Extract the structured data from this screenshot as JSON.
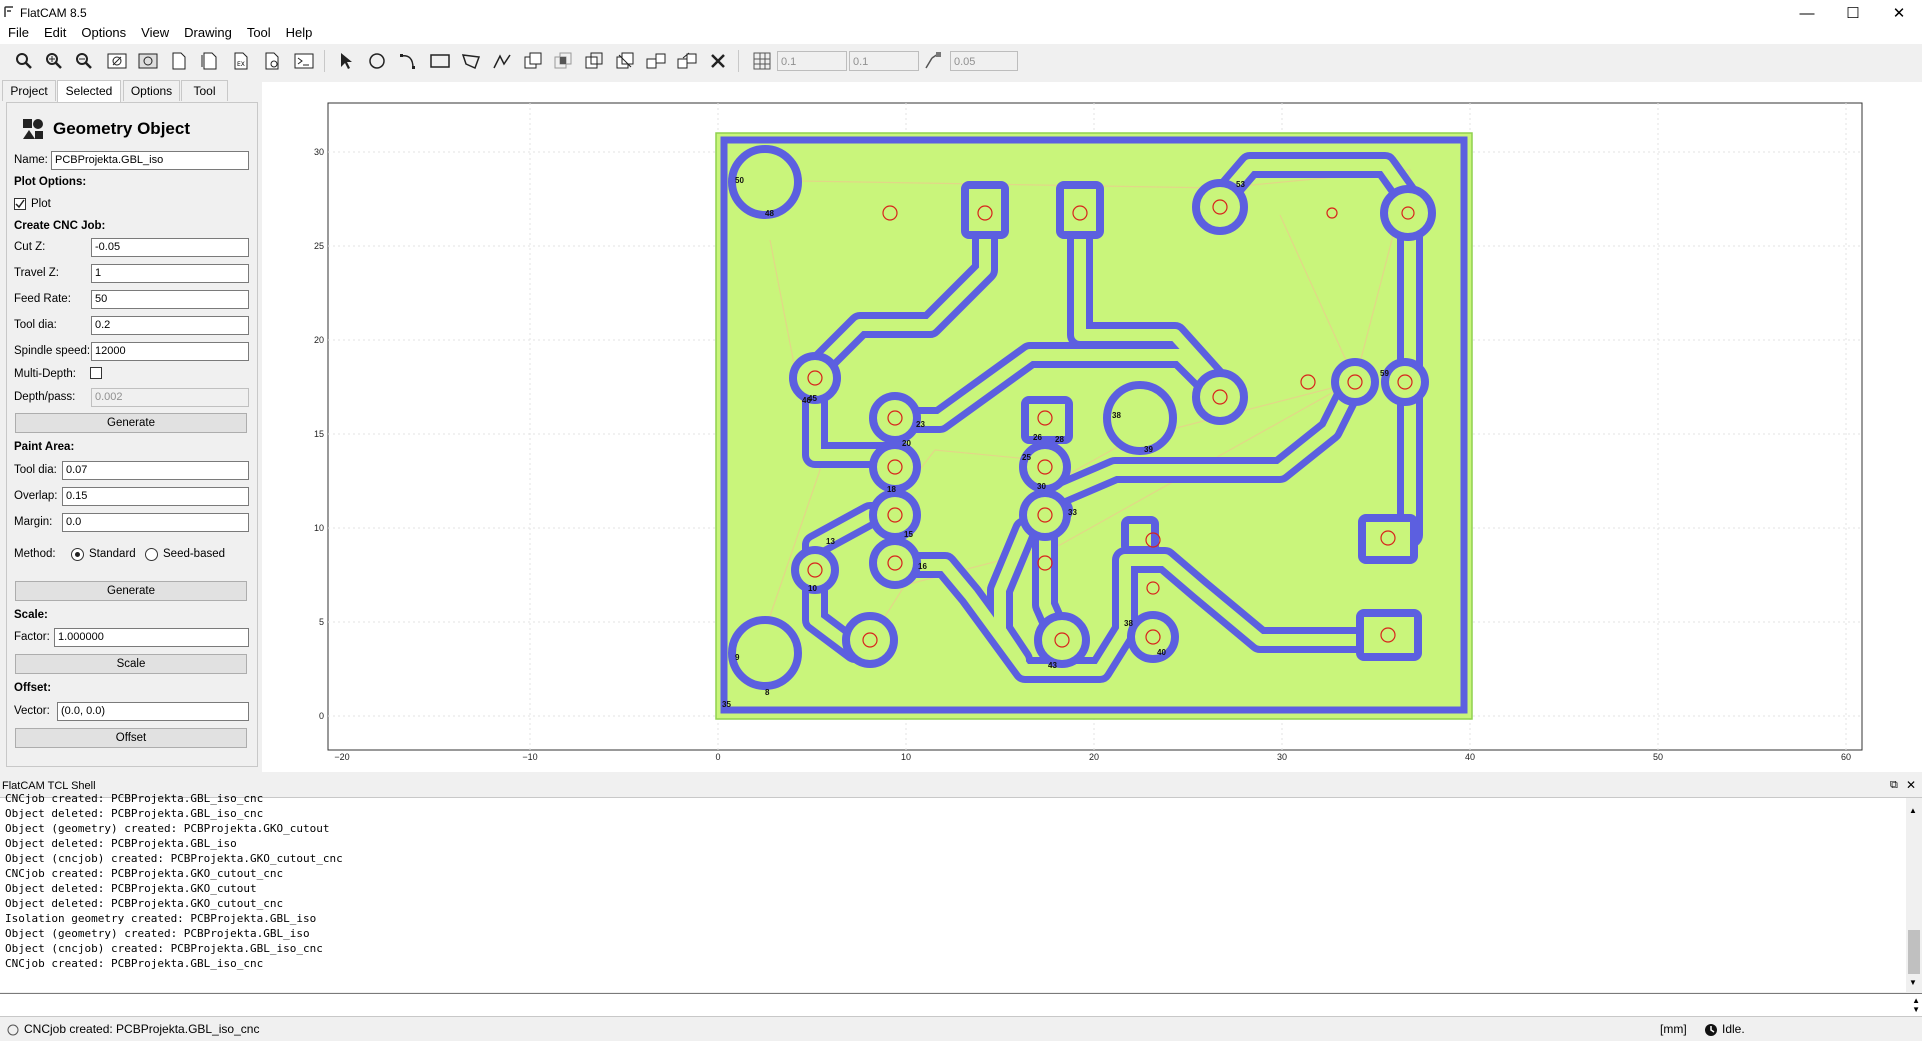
{
  "window": {
    "title": "FlatCAM 8.5"
  },
  "menu": [
    "File",
    "Edit",
    "Options",
    "View",
    "Drawing",
    "Tool",
    "Help"
  ],
  "toolbar": {
    "icons": [
      "zoom-fit-icon",
      "zoom-in-icon",
      "zoom-out-icon",
      "clear-plot-icon",
      "replot-icon",
      "new-geometry-icon",
      "open-gerber-icon",
      "open-excellon-icon",
      "open-gcode-icon",
      "shell-icon",
      "select-icon",
      "circle-icon",
      "arc-icon",
      "rectangle-icon",
      "polygon-icon",
      "path-icon",
      "union-icon",
      "move-icon",
      "copy-icon",
      "delete-icon"
    ],
    "grid_x": "0.1",
    "grid_y": "0.1",
    "snap_max": "0.05"
  },
  "tabs": [
    "Project",
    "Selected",
    "Options",
    "Tool"
  ],
  "active_tab": "Selected",
  "panel": {
    "title": "Geometry Object",
    "name_label": "Name:",
    "name_value": "PCBProjekta.GBL_iso",
    "plot_options": "Plot Options:",
    "plot_label": "Plot",
    "plot_checked": true,
    "create_cnc": "Create CNC Job:",
    "cut_z_label": "Cut Z:",
    "cut_z": "-0.05",
    "travel_z_label": "Travel Z:",
    "travel_z": "1",
    "feed_label": "Feed Rate:",
    "feed": "50",
    "tooldia_label": "Tool dia:",
    "tooldia": "0.2",
    "spindle_label": "Spindle speed:",
    "spindle": "12000",
    "multidepth_label": "Multi-Depth:",
    "depthpass_label": "Depth/pass:",
    "depthpass": "0.002",
    "generate": "Generate",
    "paint_area": "Paint Area:",
    "paint_tooldia_label": "Tool dia:",
    "paint_tooldia": "0.07",
    "overlap_label": "Overlap:",
    "overlap": "0.15",
    "margin_label": "Margin:",
    "margin": "0.0",
    "method_label": "Method:",
    "method_standard": "Standard",
    "method_seed": "Seed-based",
    "generate2": "Generate",
    "scale_head": "Scale:",
    "factor_label": "Factor:",
    "factor": "1.000000",
    "scale_btn": "Scale",
    "offset_head": "Offset:",
    "vector_label": "Vector:",
    "vector": "(0.0, 0.0)",
    "offset_btn": "Offset"
  },
  "plot": {
    "x_ticks": [
      "−20",
      "−10",
      "0",
      "10",
      "20",
      "30",
      "40",
      "50",
      "60"
    ],
    "y_ticks": [
      "0",
      "5",
      "10",
      "15",
      "20",
      "25",
      "30"
    ],
    "colors": {
      "board": "#c9f57b",
      "trace": "#5c5fe0",
      "trace_fill": "#c9f57b",
      "drill": "#d8231c",
      "travel": "#e8d08a"
    },
    "hole_labels": [
      "50",
      "48",
      "53",
      "59",
      "45",
      "46",
      "23",
      "20",
      "26",
      "28",
      "25",
      "30",
      "38",
      "39",
      "18",
      "15",
      "13",
      "33",
      "10",
      "16",
      "38",
      "40",
      "43",
      "9",
      "8",
      "35"
    ]
  },
  "shell": {
    "title": "FlatCAM TCL Shell",
    "lines": [
      "CNCjob created: PCBProjekta.GBL_iso_cnc",
      "Object deleted: PCBProjekta.GBL_iso_cnc",
      "Object (geometry) created: PCBProjekta.GKO_cutout",
      "Object deleted: PCBProjekta.GBL_iso",
      "Object (cncjob) created: PCBProjekta.GKO_cutout_cnc",
      "CNCjob created: PCBProjekta.GKO_cutout_cnc",
      "Object deleted: PCBProjekta.GKO_cutout",
      "Object deleted: PCBProjekta.GKO_cutout_cnc",
      "Isolation geometry created: PCBProjekta.GBL_iso",
      "Object (geometry) created: PCBProjekta.GBL_iso",
      "Object (cncjob) created: PCBProjekta.GBL_iso_cnc",
      "CNCjob created: PCBProjekta.GBL_iso_cnc"
    ]
  },
  "status": {
    "message": "CNCjob created: PCBProjekta.GBL_iso_cnc",
    "units": "[mm]",
    "state": "Idle."
  }
}
